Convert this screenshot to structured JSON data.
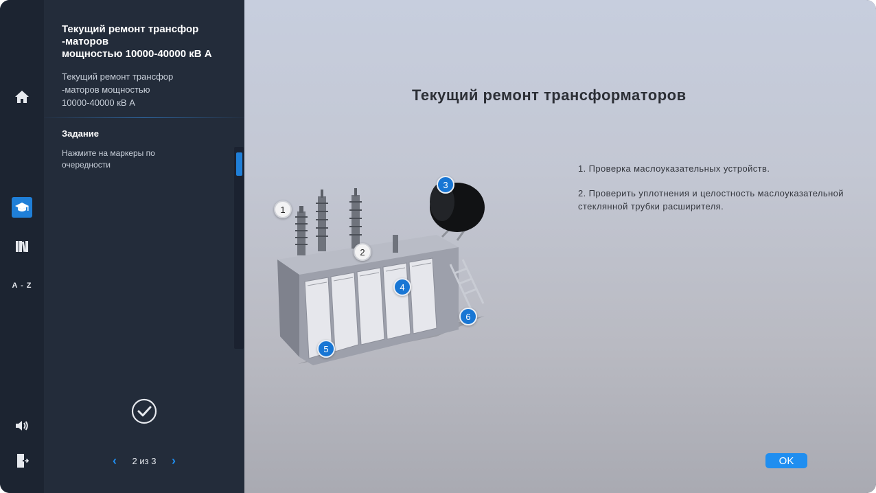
{
  "panel": {
    "course_title": "Текущий ремонт трансфор\n-маторов\nмощностью 10000-40000 кВ А",
    "course_subtitle": "Текущий ремонт трансфор\n-маторов мощностью\n10000-40000 кВ А",
    "task_heading": "Задание",
    "task_text": "Нажмите на маркеры по очередности",
    "pager_label": "2 из 3",
    "pager_prev": "‹",
    "pager_next": "›"
  },
  "rail": {
    "icons": [
      "home-icon",
      "graduation-cap-icon",
      "library-icon",
      "a-z-icon",
      "sound-icon",
      "exit-icon"
    ],
    "az_label": "A - Z"
  },
  "scene": {
    "title": "Текущий ремонт трансформаторов",
    "steps": [
      "1. Проверка маслоуказательных устройств.",
      "2. Проверить уплотнения и целостность маслоуказательной стеклянной трубки расширителя."
    ],
    "markers": [
      "1",
      "2",
      "3",
      "4",
      "5",
      "6"
    ],
    "ok_label": "OK"
  },
  "colors": {
    "accent": "#1f7fd8",
    "panel": "#232c3a",
    "rail": "#1c2431"
  }
}
